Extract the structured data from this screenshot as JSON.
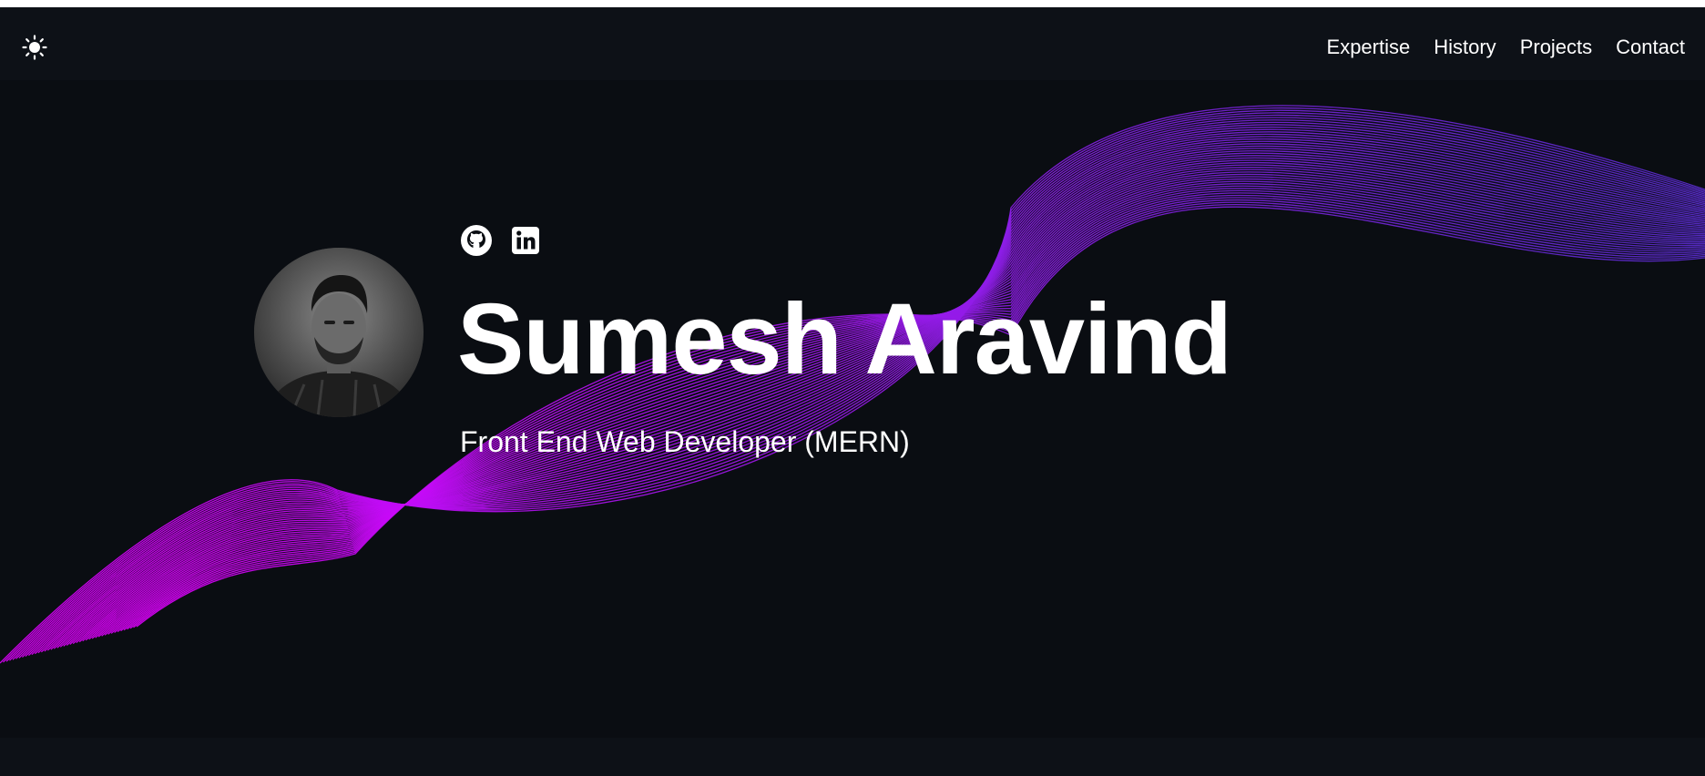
{
  "navbar": {
    "theme_toggle_icon": "sun-icon",
    "links": [
      {
        "label": "Expertise"
      },
      {
        "label": "History"
      },
      {
        "label": "Projects"
      },
      {
        "label": "Contact"
      }
    ]
  },
  "hero": {
    "avatar_icon": "profile-photo",
    "socials": [
      {
        "icon": "github-icon"
      },
      {
        "icon": "linkedin-icon"
      }
    ],
    "name": "Sumesh Aravind",
    "subtitle": "Front End Web Developer (MERN)"
  },
  "colors": {
    "page_bg": "#0d1117",
    "hero_bg": "#0a0d12",
    "text": "#ffffff",
    "wave_magenta": "#e000ff",
    "wave_purple": "#8a1ee6",
    "wave_indigo": "#5a2ccf"
  }
}
